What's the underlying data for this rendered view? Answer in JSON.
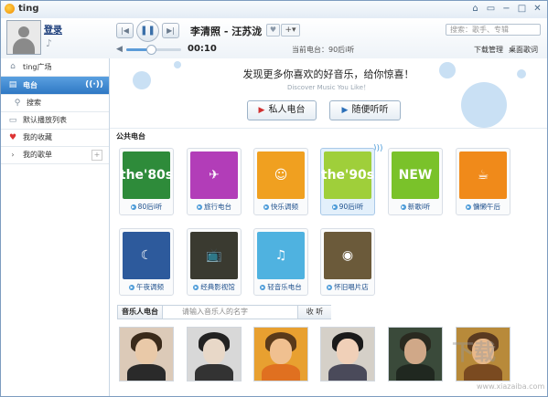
{
  "titlebar": {
    "app_name": "ting",
    "buttons": [
      "⌂",
      "▭",
      "−",
      "□",
      "✕"
    ]
  },
  "header": {
    "login": "登录",
    "song_title": "李清照 - 汪苏泷",
    "time": "00:10",
    "current_station_label": "当前电台：",
    "current_station": "90后i听",
    "download_manager": "下载管理",
    "desktop_lyrics": "桌面歌词",
    "search_placeholder": "搜索：歌手、专辑",
    "volume": 0.5
  },
  "sidebar": {
    "plaza": "ting广场",
    "radio": "电台",
    "search": "搜索",
    "default_playlist": "默认播放列表",
    "favorites": "我的收藏",
    "my_songlist": "我的歌单"
  },
  "banner": {
    "slogan": "发现更多你喜欢的好音乐，给你惊喜！",
    "slogan_en": "Discover Music You Like！",
    "private_radio": "私人电台",
    "random_listen": "随便听听"
  },
  "public_section_title": "公共电台",
  "stations": [
    {
      "label": "80后i听",
      "art": "the'80s",
      "color": "#2e8b3a",
      "icon": "radio-icon"
    },
    {
      "label": "旅行电台",
      "art": "✈",
      "color": "#b23db8",
      "icon": "luggage-icon"
    },
    {
      "label": "快乐调频",
      "art": "☺",
      "color": "#f0a020",
      "icon": "smiley-icon"
    },
    {
      "label": "90后i听",
      "art": "the'90s",
      "color": "#9fcf3a",
      "icon": "phone-icon"
    },
    {
      "label": "新歌i听",
      "art": "NEW",
      "color": "#7ac22a",
      "icon": "egg-icon"
    },
    {
      "label": "慵懒午后",
      "art": "☕",
      "color": "#f08a1a",
      "icon": "coffee-icon"
    },
    {
      "label": "午夜调频",
      "art": "☾",
      "color": "#2d5a9c",
      "icon": "streetlamp-icon"
    },
    {
      "label": "经典影视馆",
      "art": "📺",
      "color": "#3a3a30",
      "icon": "tv-icon"
    },
    {
      "label": "轻音乐电台",
      "art": "♫",
      "color": "#4fb2e0",
      "icon": "music-icon"
    },
    {
      "label": "怀旧唱片店",
      "art": "◉",
      "color": "#6b5a3a",
      "icon": "gramophone-icon"
    }
  ],
  "musician": {
    "label": "音乐人电台",
    "placeholder": "请输入音乐人的名字",
    "button": "收 听"
  },
  "photos": [
    {
      "bg": "#dccab8",
      "hair": "#3a2a1a",
      "skin": "#e9c9a8",
      "body": "#2a2a2a"
    },
    {
      "bg": "#d8d8d8",
      "hair": "#222222",
      "skin": "#e8d8c8",
      "body": "#333333"
    },
    {
      "bg": "#e8a030",
      "hair": "#5a3a1a",
      "skin": "#f0c090",
      "body": "#e07020"
    },
    {
      "bg": "#d5d0c8",
      "hair": "#1a1a1a",
      "skin": "#f0d0b8",
      "body": "#4a4a5a"
    },
    {
      "bg": "#3a4a3a",
      "hair": "#2a2a20",
      "skin": "#d0a888",
      "body": "#202820"
    },
    {
      "bg": "#b88a3a",
      "hair": "#5a3a20",
      "skin": "#e8b88a",
      "body": "#7a4a20"
    }
  ],
  "watermark": {
    "text": "下载",
    "url": "www.xiazaiba.com"
  }
}
